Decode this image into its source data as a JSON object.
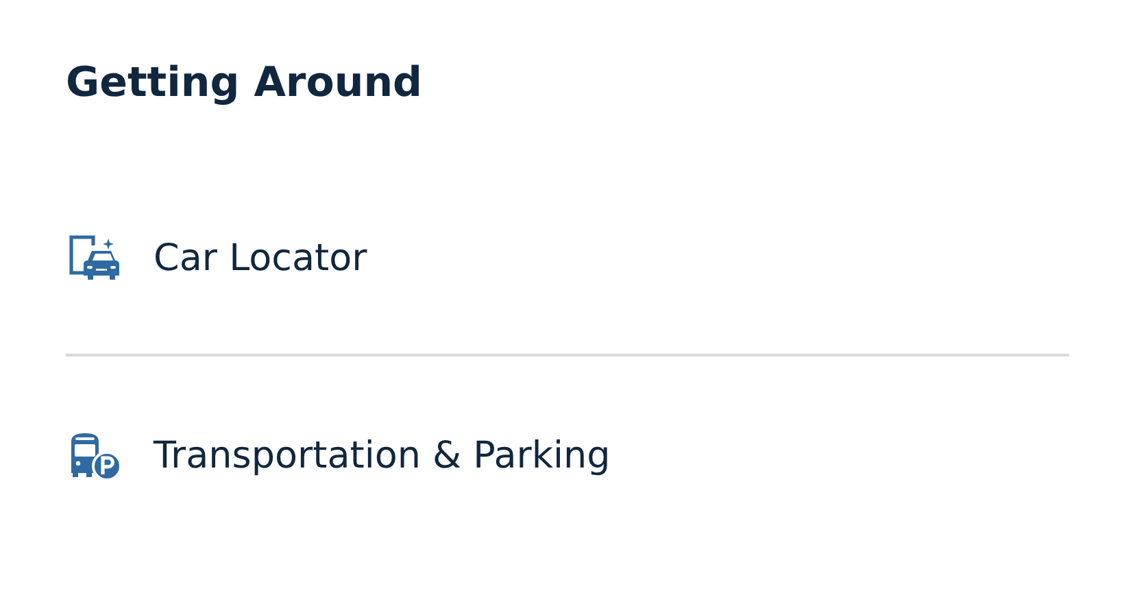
{
  "section": {
    "title": "Getting Around"
  },
  "items": [
    {
      "label": "Car Locator",
      "kind": "car"
    },
    {
      "label": "Transportation & Parking",
      "kind": "bus-parking"
    }
  ]
}
